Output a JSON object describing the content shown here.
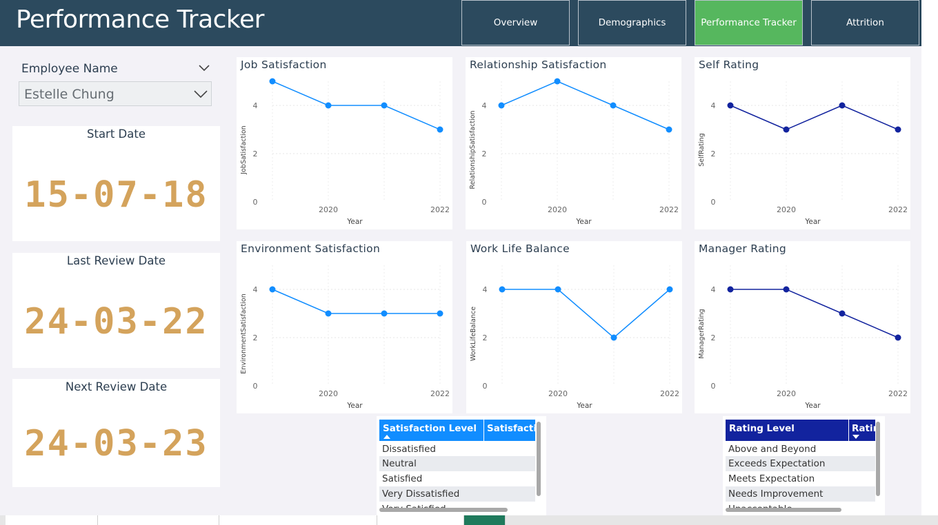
{
  "app": {
    "title": "Performance Tracker"
  },
  "nav": {
    "tabs": [
      {
        "label": "Overview",
        "active": false
      },
      {
        "label": "Demographics",
        "active": false
      },
      {
        "label": "Performance Tracker",
        "active": true
      },
      {
        "label": "Attrition",
        "active": false
      }
    ]
  },
  "slicer": {
    "label": "Employee Name",
    "value": "Estelle Chung"
  },
  "cards": [
    {
      "title": "Start Date",
      "value": "15-07-18"
    },
    {
      "title": "Last Review Date",
      "value": "24-03-22"
    },
    {
      "title": "Next Review Date",
      "value": "24-03-23"
    }
  ],
  "colors": {
    "light_series": "#118dff",
    "dark_series": "#12239e",
    "header": "#2c4a5e",
    "active_tab": "#56b75e",
    "card_value": "#d4a35c"
  },
  "chart_data": [
    {
      "type": "line",
      "title": "Job Satisfaction",
      "xlabel": "Year",
      "ylabel": "JobSatisfaction",
      "x": [
        2019,
        2020,
        2021,
        2022
      ],
      "values": [
        5,
        4,
        4,
        3
      ],
      "xticks": [
        "2020",
        "2022"
      ],
      "yticks": [
        "0",
        "2",
        "4"
      ],
      "ylim": [
        0,
        5
      ],
      "color": "#118dff"
    },
    {
      "type": "line",
      "title": "Relationship Satisfaction",
      "xlabel": "Year",
      "ylabel": "RelationshipSatisfaction",
      "x": [
        2019,
        2020,
        2021,
        2022
      ],
      "values": [
        4,
        5,
        4,
        3
      ],
      "xticks": [
        "2020",
        "2022"
      ],
      "yticks": [
        "0",
        "2",
        "4"
      ],
      "ylim": [
        0,
        5
      ],
      "color": "#118dff"
    },
    {
      "type": "line",
      "title": "Self Rating",
      "xlabel": "Year",
      "ylabel": "SelfRating",
      "x": [
        2019,
        2020,
        2021,
        2022
      ],
      "values": [
        4,
        3,
        4,
        3
      ],
      "xticks": [
        "2020",
        "2022"
      ],
      "yticks": [
        "0",
        "2",
        "4"
      ],
      "ylim": [
        0,
        5
      ],
      "color": "#12239e"
    },
    {
      "type": "line",
      "title": "Environment Satisfaction",
      "xlabel": "Year",
      "ylabel": "EnvironmentSatisfaction",
      "x": [
        2019,
        2020,
        2021,
        2022
      ],
      "values": [
        4,
        3,
        3,
        3
      ],
      "xticks": [
        "2020",
        "2022"
      ],
      "yticks": [
        "0",
        "2",
        "4"
      ],
      "ylim": [
        0,
        5
      ],
      "color": "#118dff"
    },
    {
      "type": "line",
      "title": "Work Life Balance",
      "xlabel": "Year",
      "ylabel": "WorkLifeBalance",
      "x": [
        2019,
        2020,
        2021,
        2022
      ],
      "values": [
        4,
        4,
        2,
        4
      ],
      "xticks": [
        "2020",
        "2022"
      ],
      "yticks": [
        "0",
        "2",
        "4"
      ],
      "ylim": [
        0,
        5
      ],
      "color": "#118dff"
    },
    {
      "type": "line",
      "title": "Manager Rating",
      "xlabel": "Year",
      "ylabel": "ManagerRating",
      "x": [
        2019,
        2020,
        2021,
        2022
      ],
      "values": [
        4,
        4,
        3,
        2
      ],
      "xticks": [
        "2020",
        "2022"
      ],
      "yticks": [
        "0",
        "2",
        "4"
      ],
      "ylim": [
        0,
        5
      ],
      "color": "#12239e"
    }
  ],
  "tables": [
    {
      "header1": "Satisfaction Level",
      "header2": "Satisfactio",
      "sort": "ascending",
      "rows": [
        "Dissatisfied",
        "Neutral",
        "Satisfied",
        "Very Dissatisfied",
        "Very Satisfied"
      ]
    },
    {
      "header1": "Rating Level",
      "header2": "Ratin",
      "sort": "descending",
      "rows": [
        "Above and Beyond",
        "Exceeds Expectation",
        "Meets Expectation",
        "Needs Improvement",
        "Unacceptable"
      ]
    }
  ]
}
